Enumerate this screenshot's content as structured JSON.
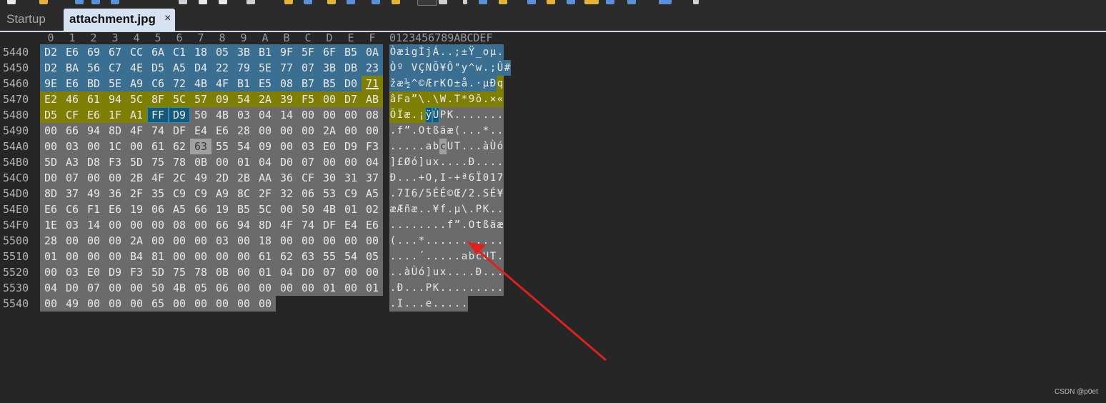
{
  "tabs": {
    "startup": "Startup",
    "active": "attachment.jpg",
    "close": "×"
  },
  "hex_header": [
    "0",
    "1",
    "2",
    "3",
    "4",
    "5",
    "6",
    "7",
    "8",
    "9",
    "A",
    "B",
    "C",
    "D",
    "E",
    "F"
  ],
  "ascii_header": "0123456789ABCDEF",
  "rows": [
    {
      "offset": "5440",
      "hex": [
        "D2",
        "E6",
        "69",
        "67",
        "CC",
        "6A",
        "C1",
        "18",
        "05",
        "3B",
        "B1",
        "9F",
        "5F",
        "6F",
        "B5",
        "0A"
      ],
      "ascii": "ÒæigÌjÁ..;±Ÿ_oµ."
    },
    {
      "offset": "5450",
      "hex": [
        "D2",
        "BA",
        "56",
        "C7",
        "4E",
        "D5",
        "A5",
        "D4",
        "22",
        "79",
        "5E",
        "77",
        "07",
        "3B",
        "DB",
        "23"
      ],
      "ascii": "Òº VÇNÕ¥Ô\"y^w.;Û#"
    },
    {
      "offset": "5460",
      "hex": [
        "9E",
        "E6",
        "BD",
        "5E",
        "A9",
        "C6",
        "72",
        "4B",
        "4F",
        "B1",
        "E5",
        "08",
        "B7",
        "B5",
        "D0",
        "71"
      ],
      "ascii": "žæ½^©ÆrKO±å.·µÐq"
    },
    {
      "offset": "5470",
      "hex": [
        "E2",
        "46",
        "61",
        "94",
        "5C",
        "8F",
        "5C",
        "57",
        "09",
        "54",
        "2A",
        "39",
        "F5",
        "00",
        "D7",
        "AB"
      ],
      "ascii": "âFa”\\.\\W.T*9õ.×«"
    },
    {
      "offset": "5480",
      "hex": [
        "D5",
        "CF",
        "E6",
        "1F",
        "A1",
        "FF",
        "D9",
        "50",
        "4B",
        "03",
        "04",
        "14",
        "00",
        "00",
        "00",
        "08"
      ],
      "ascii": "ÕÏæ.¡ÿÙPK......."
    },
    {
      "offset": "5490",
      "hex": [
        "00",
        "66",
        "94",
        "8D",
        "4F",
        "74",
        "DF",
        "E4",
        "E6",
        "28",
        "00",
        "00",
        "00",
        "2A",
        "00",
        "00"
      ],
      "ascii": ".f”.Otßäæ(...*.."
    },
    {
      "offset": "54A0",
      "hex": [
        "00",
        "03",
        "00",
        "1C",
        "00",
        "61",
        "62",
        "63",
        "55",
        "54",
        "09",
        "00",
        "03",
        "E0",
        "D9",
        "F3"
      ],
      "ascii": ".....abcUT...àÙó"
    },
    {
      "offset": "54B0",
      "hex": [
        "5D",
        "A3",
        "D8",
        "F3",
        "5D",
        "75",
        "78",
        "0B",
        "00",
        "01",
        "04",
        "D0",
        "07",
        "00",
        "00",
        "04"
      ],
      "ascii": "]£Øó]ux....Ð...."
    },
    {
      "offset": "54C0",
      "hex": [
        "D0",
        "07",
        "00",
        "00",
        "2B",
        "4F",
        "2C",
        "49",
        "2D",
        "2B",
        "AA",
        "36",
        "CF",
        "30",
        "31",
        "37"
      ],
      "ascii": "Ð...+O,I-+ª6Ï017"
    },
    {
      "offset": "54D0",
      "hex": [
        "8D",
        "37",
        "49",
        "36",
        "2F",
        "35",
        "C9",
        "C9",
        "A9",
        "8C",
        "2F",
        "32",
        "06",
        "53",
        "C9",
        "A5"
      ],
      "ascii": ".7I6/5ÉÉ©Œ/2.SÉ¥"
    },
    {
      "offset": "54E0",
      "hex": [
        "E6",
        "C6",
        "F1",
        "E6",
        "19",
        "06",
        "A5",
        "66",
        "19",
        "B5",
        "5C",
        "00",
        "50",
        "4B",
        "01",
        "02"
      ],
      "ascii": "æÆñæ..¥f.µ\\.PK.."
    },
    {
      "offset": "54F0",
      "hex": [
        "1E",
        "03",
        "14",
        "00",
        "00",
        "00",
        "08",
        "00",
        "66",
        "94",
        "8D",
        "4F",
        "74",
        "DF",
        "E4",
        "E6"
      ],
      "ascii": "........f”.Otßäæ"
    },
    {
      "offset": "5500",
      "hex": [
        "28",
        "00",
        "00",
        "00",
        "2A",
        "00",
        "00",
        "00",
        "03",
        "00",
        "18",
        "00",
        "00",
        "00",
        "00",
        "00"
      ],
      "ascii": "(...*..........."
    },
    {
      "offset": "5510",
      "hex": [
        "01",
        "00",
        "00",
        "00",
        "B4",
        "81",
        "00",
        "00",
        "00",
        "00",
        "61",
        "62",
        "63",
        "55",
        "54",
        "05"
      ],
      "ascii": "....´.....abcUT."
    },
    {
      "offset": "5520",
      "hex": [
        "00",
        "03",
        "E0",
        "D9",
        "F3",
        "5D",
        "75",
        "78",
        "0B",
        "00",
        "01",
        "04",
        "D0",
        "07",
        "00",
        "00"
      ],
      "ascii": "..àÙó]ux....Ð..."
    },
    {
      "offset": "5530",
      "hex": [
        "04",
        "D0",
        "07",
        "00",
        "00",
        "50",
        "4B",
        "05",
        "06",
        "00",
        "00",
        "00",
        "00",
        "01",
        "00",
        "01"
      ],
      "ascii": ".Ð...PK........."
    },
    {
      "offset": "5540",
      "hex": [
        "00",
        "49",
        "00",
        "00",
        "00",
        "65",
        "00",
        "00",
        "00",
        "00",
        "00"
      ],
      "ascii": ".I...e....."
    }
  ],
  "highlight_colors": {
    "selection_blue": "#3a6f91",
    "olive": "#7f7f06",
    "gray": "#6b6b6b",
    "teal": "#14597a",
    "arrow_red": "#e0201f"
  },
  "watermark": "CSDN @p0et"
}
